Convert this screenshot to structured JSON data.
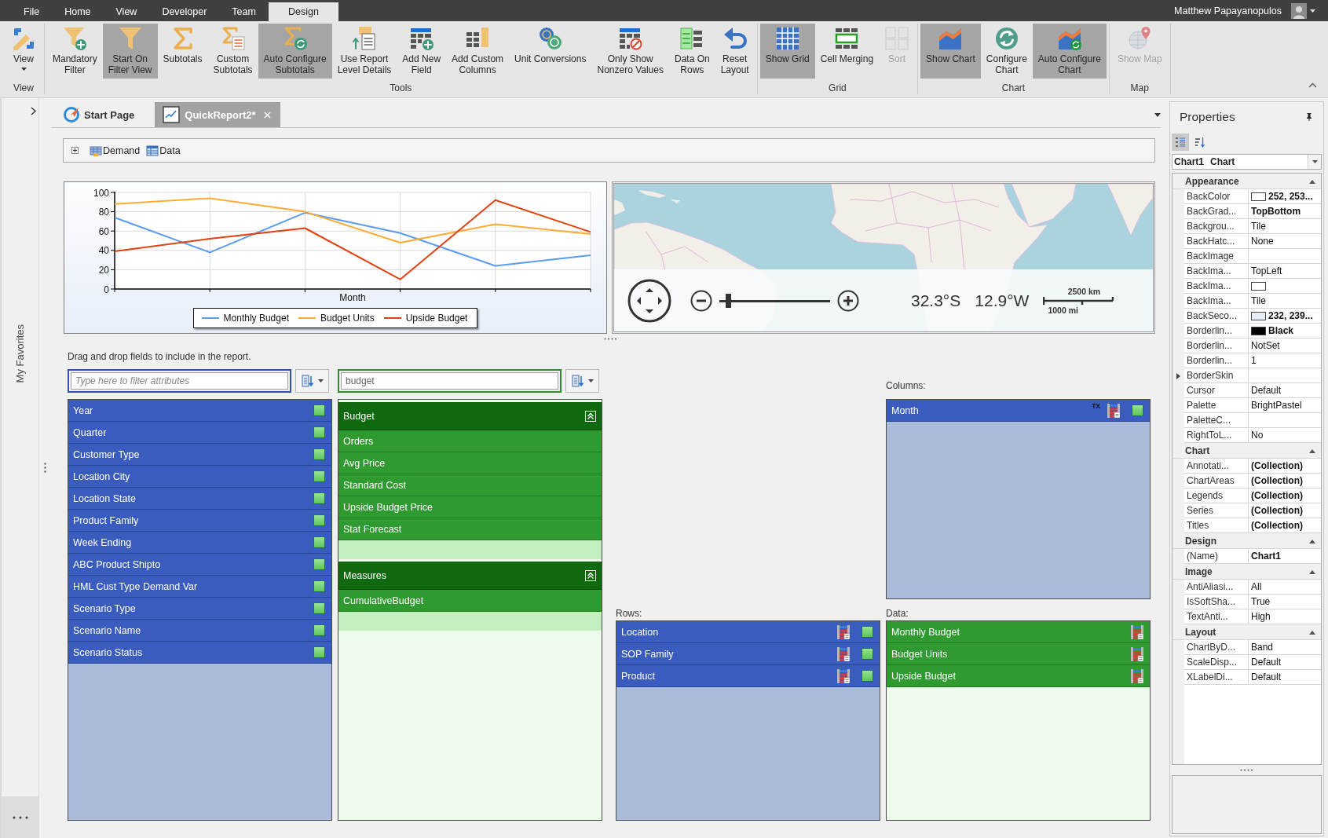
{
  "menu_bar": {
    "tabs": [
      {
        "label": "File",
        "selected": false
      },
      {
        "label": "Home",
        "selected": false
      },
      {
        "label": "View",
        "selected": false
      },
      {
        "label": "Developer",
        "selected": false
      },
      {
        "label": "Team",
        "selected": false
      },
      {
        "label": "Design",
        "selected": true
      }
    ],
    "user_name": "Matthew Papayanopulos"
  },
  "ribbon": {
    "groups": [
      {
        "label": "View",
        "buttons": [
          {
            "label": "View",
            "pressed": false,
            "disabled": false,
            "dropdown": true
          }
        ]
      },
      {
        "label": "Tools",
        "buttons": [
          {
            "label": "Mandatory\nFilter",
            "pressed": false,
            "disabled": false,
            "dropdown": false
          },
          {
            "label": "Start On\nFilter View",
            "pressed": true,
            "disabled": false,
            "dropdown": false
          },
          {
            "label": "Subtotals",
            "pressed": false,
            "disabled": false,
            "dropdown": false
          },
          {
            "label": "Custom\nSubtotals",
            "pressed": false,
            "disabled": false,
            "dropdown": false
          },
          {
            "label": "Auto Configure\nSubtotals",
            "pressed": true,
            "disabled": false,
            "dropdown": false
          },
          {
            "label": "Use Report\nLevel Details",
            "pressed": false,
            "disabled": false,
            "dropdown": false
          },
          {
            "label": "Add New\nField",
            "pressed": false,
            "disabled": false,
            "dropdown": false
          },
          {
            "label": "Add Custom\nColumns",
            "pressed": false,
            "disabled": false,
            "dropdown": false
          },
          {
            "label": "Unit Conversions",
            "pressed": false,
            "disabled": false,
            "dropdown": false
          },
          {
            "label": "Only Show\nNonzero Values",
            "pressed": false,
            "disabled": false,
            "dropdown": false
          },
          {
            "label": "Data On\nRows",
            "pressed": false,
            "disabled": false,
            "dropdown": false
          },
          {
            "label": "Reset\nLayout",
            "pressed": false,
            "disabled": false,
            "dropdown": false
          }
        ]
      },
      {
        "label": "Grid",
        "buttons": [
          {
            "label": "Show Grid",
            "pressed": true,
            "disabled": false,
            "dropdown": false
          },
          {
            "label": "Cell Merging",
            "pressed": false,
            "disabled": false,
            "dropdown": false
          },
          {
            "label": "Sort",
            "pressed": false,
            "disabled": true,
            "dropdown": false
          }
        ]
      },
      {
        "label": "Chart",
        "buttons": [
          {
            "label": "Show Chart",
            "pressed": true,
            "disabled": false,
            "dropdown": false
          },
          {
            "label": "Configure\nChart",
            "pressed": false,
            "disabled": false,
            "dropdown": false
          },
          {
            "label": "Auto Configure\nChart",
            "pressed": true,
            "disabled": false,
            "dropdown": false
          }
        ]
      },
      {
        "label": "Map",
        "buttons": [
          {
            "label": "Show Map",
            "pressed": false,
            "disabled": true,
            "dropdown": false
          }
        ]
      }
    ]
  },
  "sidebar": {
    "label": "My Favorites"
  },
  "document_tabs": [
    {
      "label": "Start Page",
      "selected": false
    },
    {
      "label": "QuickReport2*",
      "selected": true
    }
  ],
  "breadcrumb": {
    "expanded": false,
    "items": [
      {
        "label": "Demand"
      },
      {
        "label": "Data"
      }
    ]
  },
  "chart": {
    "chart_data": {
      "type": "line",
      "xlabel": "Month",
      "categories": [
        null,
        null,
        null,
        null,
        null,
        null
      ],
      "ylim": [
        0,
        100
      ],
      "yticks": [
        0,
        20,
        40,
        60,
        80,
        100
      ],
      "grid": true,
      "legend": "bottom",
      "series": [
        {
          "name": "Monthly Budget",
          "color": "#5b9bf0",
          "values": [
            74,
            38,
            79,
            58,
            24,
            35
          ]
        },
        {
          "name": "Budget Units",
          "color": "#ffaa33",
          "values": [
            88,
            94,
            80,
            48,
            67,
            57
          ]
        },
        {
          "name": "Upside Budget",
          "color": "#e2410f",
          "values": [
            39,
            52,
            63,
            10,
            92,
            59
          ]
        }
      ]
    }
  },
  "map": {
    "latitude": "32.3°S",
    "longitude": "12.9°W",
    "scale_km": "2500 km",
    "scale_mi": "1000 mi",
    "zoom": {
      "level": 0.08
    }
  },
  "field_chooser": {
    "instruction": "Drag and drop fields to include in the report.",
    "attributes": {
      "placeholder": "Type here to filter attributes",
      "items": [
        "Year",
        "Quarter",
        "Customer Type",
        "Location City",
        "Location State",
        "Product Family",
        "Week Ending",
        "ABC Product Shipto",
        "HML Cust Type Demand Var",
        "Scenario Type",
        "Scenario Name",
        "Scenario Status"
      ]
    },
    "measures": {
      "value": "budget",
      "groups": [
        {
          "label": "Budget",
          "expanded": true,
          "items": [
            "Orders",
            "Avg Price",
            "Standard Cost",
            "Upside Budget Price",
            "Stat Forecast"
          ]
        },
        {
          "label": "Measures",
          "expanded": true,
          "items": [
            "CumulativeBudget"
          ]
        }
      ]
    },
    "columns": {
      "label": "Columns:",
      "items": [
        {
          "label": "Month",
          "tag": "TX"
        }
      ]
    },
    "rows": {
      "label": "Rows:",
      "items": [
        {
          "label": "Location"
        },
        {
          "label": "SOP Family"
        },
        {
          "label": "Product"
        }
      ]
    },
    "data": {
      "label": "Data:",
      "items": [
        {
          "label": "Monthly Budget"
        },
        {
          "label": "Budget Units"
        },
        {
          "label": "Upside Budget"
        }
      ]
    }
  },
  "properties": {
    "title": "Properties",
    "tools": [
      {
        "selected": true
      },
      {
        "selected": false
      }
    ],
    "object": {
      "name": "Chart1",
      "type": "Chart"
    },
    "categories": [
      {
        "label": "Appearance",
        "expanded": true,
        "items": [
          {
            "name": "BackColor",
            "value": "252, 253...",
            "modified": true,
            "color": "#fcfdff"
          },
          {
            "name": "BackGrad...",
            "value": "TopBottom",
            "modified": true
          },
          {
            "name": "Backgrou...",
            "value": "Tile",
            "modified": false
          },
          {
            "name": "BackHatc...",
            "value": "None",
            "modified": false
          },
          {
            "name": "BackImage"
          },
          {
            "name": "BackIma...",
            "value": "TopLeft",
            "modified": false
          },
          {
            "name": "BackIma...",
            "color": "#ffffff"
          },
          {
            "name": "BackIma...",
            "value": "Tile",
            "modified": false
          },
          {
            "name": "BackSeco...",
            "value": "232, 239...",
            "modified": true,
            "color": "#e8eff8"
          },
          {
            "name": "Borderlin...",
            "value": "Black",
            "modified": true,
            "color": "#000000"
          },
          {
            "name": "Borderlin...",
            "value": "NotSet",
            "modified": false
          },
          {
            "name": "Borderlin...",
            "value": "1",
            "modified": false
          },
          {
            "name": "BorderSkin",
            "expanded": false
          },
          {
            "name": "Cursor",
            "value": "Default",
            "modified": false
          },
          {
            "name": "Palette",
            "value": "BrightPastel",
            "modified": false
          },
          {
            "name": "PaletteC..."
          },
          {
            "name": "RightToL...",
            "value": "No",
            "modified": false
          }
        ]
      },
      {
        "label": "Chart",
        "expanded": true,
        "items": [
          {
            "name": "Annotati...",
            "value": "(Collection)",
            "modified": true
          },
          {
            "name": "ChartAreas",
            "value": "(Collection)",
            "modified": true
          },
          {
            "name": "Legends",
            "value": "(Collection)",
            "modified": true
          },
          {
            "name": "Series",
            "value": "(Collection)",
            "modified": true
          },
          {
            "name": "Titles",
            "value": "(Collection)",
            "modified": true
          }
        ]
      },
      {
        "label": "Design",
        "expanded": true,
        "items": [
          {
            "name": "(Name)",
            "value": "Chart1",
            "modified": true
          }
        ]
      },
      {
        "label": "Image",
        "expanded": true,
        "items": [
          {
            "name": "AntiAliasi...",
            "value": "All",
            "modified": false
          },
          {
            "name": "IsSoftSha...",
            "value": "True",
            "modified": false
          },
          {
            "name": "TextAnti...",
            "value": "High",
            "modified": false
          }
        ]
      },
      {
        "label": "Layout",
        "expanded": true,
        "items": [
          {
            "name": "ChartByD...",
            "value": "Band",
            "modified": false
          },
          {
            "name": "ScaleDisp...",
            "value": "Default",
            "modified": false
          },
          {
            "name": "XLabelDi...",
            "value": "Default",
            "modified": false
          }
        ]
      }
    ]
  }
}
